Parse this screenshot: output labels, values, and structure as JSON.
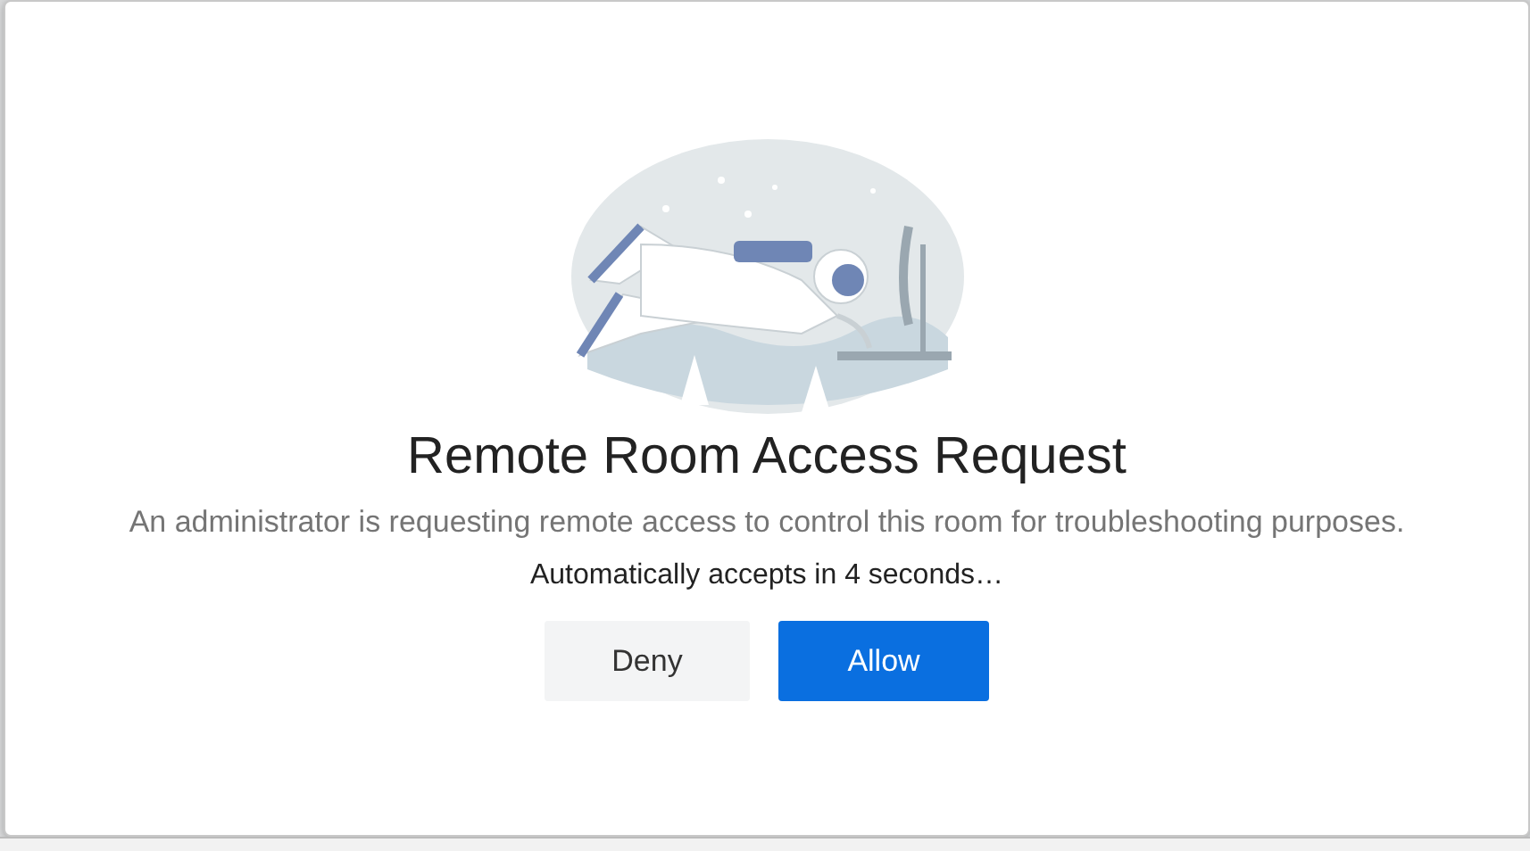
{
  "dialog": {
    "title": "Remote Room Access Request",
    "message": "An administrator is requesting remote access to control this room for troubleshooting purposes.",
    "countdown": "Automatically accepts in 4 seconds…",
    "buttons": [
      {
        "label": "Deny",
        "kind": "secondary"
      },
      {
        "label": "Allow",
        "kind": "primary"
      }
    ]
  }
}
